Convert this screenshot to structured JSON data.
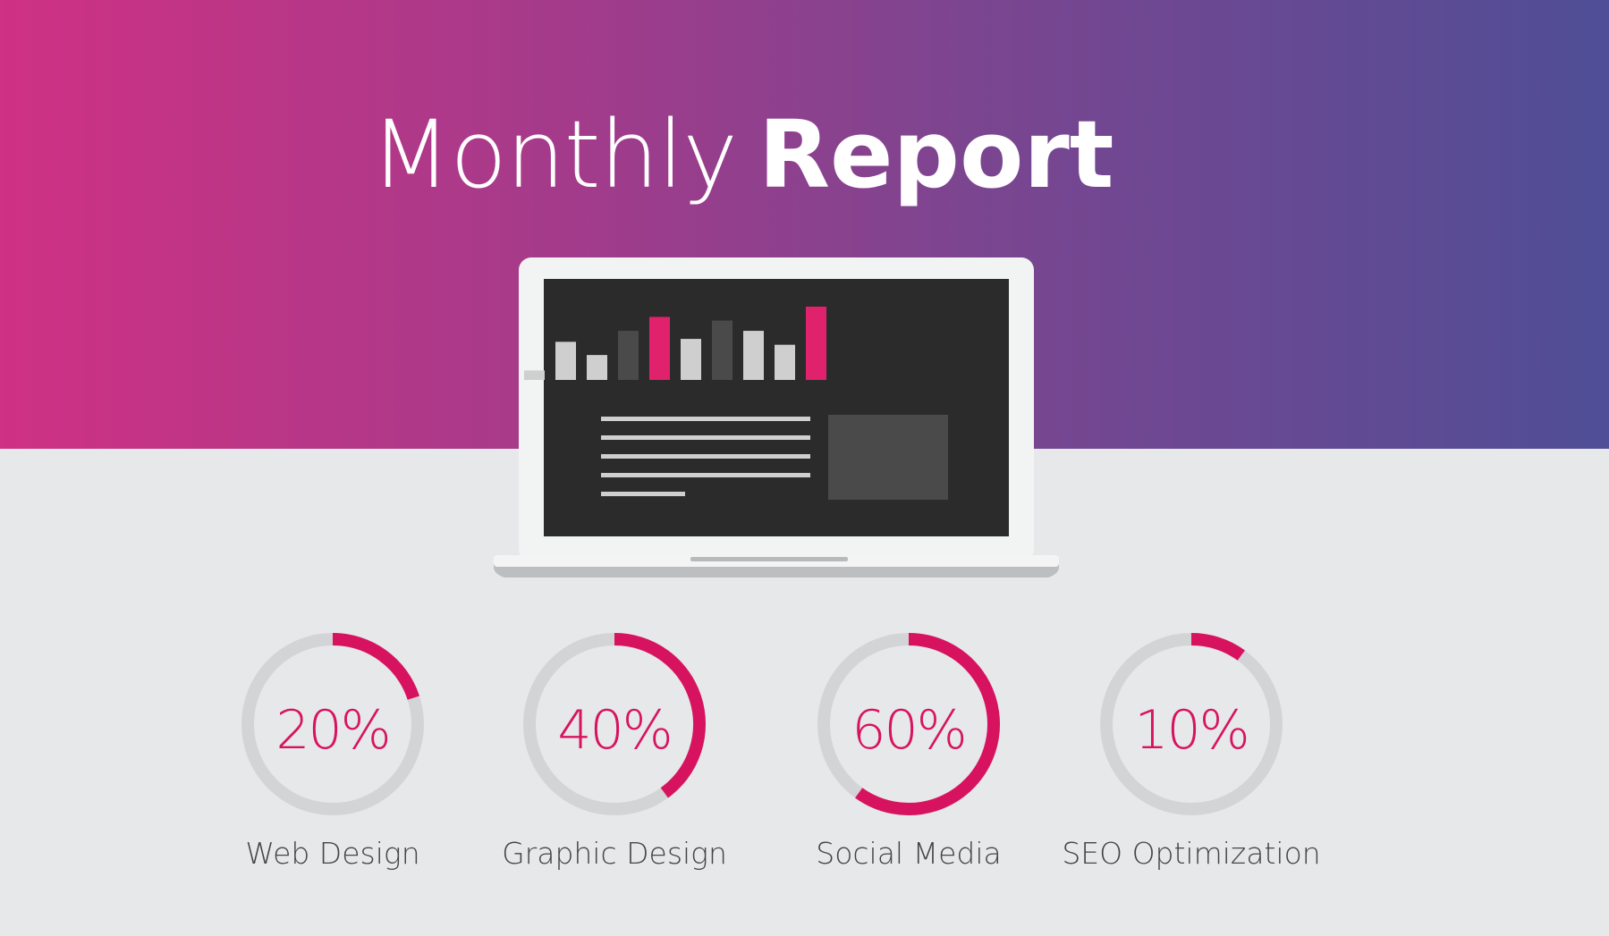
{
  "header": {
    "title_light": "Monthly",
    "title_bold": "Report"
  },
  "colors": {
    "accent": "#d7135f",
    "track": "#d3d4d6",
    "screen": "#2b2b2b",
    "bar_light": "#cfcfcf",
    "bar_dark": "#4a4a4a",
    "bar_accent": "#e0226d"
  },
  "laptop_bars": [
    {
      "level": 0.13,
      "tone": "light"
    },
    {
      "level": 0.52,
      "tone": "light"
    },
    {
      "level": 0.34,
      "tone": "light"
    },
    {
      "level": 0.67,
      "tone": "dark"
    },
    {
      "level": 0.86,
      "tone": "accent"
    },
    {
      "level": 0.56,
      "tone": "light"
    },
    {
      "level": 0.81,
      "tone": "dark"
    },
    {
      "level": 0.67,
      "tone": "light"
    },
    {
      "level": 0.48,
      "tone": "light"
    },
    {
      "level": 1.0,
      "tone": "accent"
    }
  ],
  "stats": [
    {
      "value_text": "20%",
      "fraction": 0.2,
      "label": "Web Design"
    },
    {
      "value_text": "40%",
      "fraction": 0.4,
      "label": "Graphic Design"
    },
    {
      "value_text": "60%",
      "fraction": 0.6,
      "label": "Social Media"
    },
    {
      "value_text": "10%",
      "fraction": 0.1,
      "label": "SEO Optimization"
    }
  ]
}
